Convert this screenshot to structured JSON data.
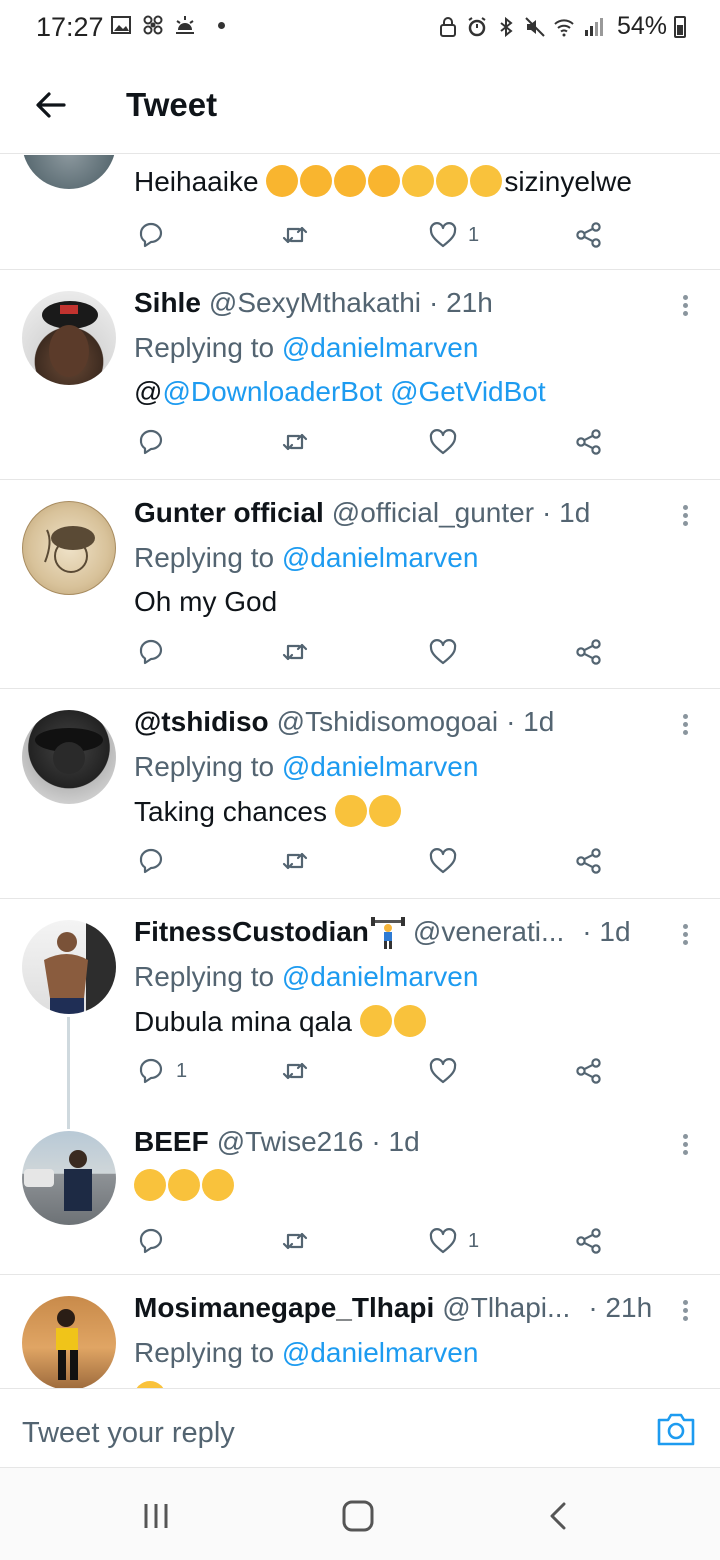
{
  "status_bar": {
    "time": "17:27",
    "battery": "54%",
    "left_icons": [
      "gallery-icon",
      "fan-icon",
      "weather-icon"
    ],
    "right_icons": [
      "lock-icon",
      "alarm-icon",
      "bluetooth-icon",
      "mute-icon",
      "wifi-icon",
      "signal-icon"
    ]
  },
  "header": {
    "title": "Tweet"
  },
  "tweets": [
    {
      "text_prefix": "Heihaaike",
      "emojis": [
        "angry",
        "angry",
        "angry",
        "angry",
        "cry",
        "cry",
        "cry"
      ],
      "text_suffix": "sizinyelwe",
      "reply_count": "",
      "like_count": "1"
    },
    {
      "name": "Sihle",
      "handle": "@SexyMthakathi",
      "time": "· 21h",
      "replying_label": "Replying to",
      "replying_to": "@danielmarven",
      "text_prefix": "@",
      "mentions": "@DownloaderBot @GetVidBot",
      "reply_count": "",
      "like_count": ""
    },
    {
      "name": "Gunter official",
      "handle": "@official_gunter",
      "time": "· 1d",
      "replying_label": "Replying to",
      "replying_to": "@danielmarven",
      "text": "Oh my God",
      "reply_count": "",
      "like_count": ""
    },
    {
      "name": "@tshidiso",
      "handle": "@Tshidisomogoai",
      "time": "· 1d",
      "replying_label": "Replying to",
      "replying_to": "@danielmarven",
      "text": "Taking chances",
      "emojis": [
        "laugh",
        "laugh"
      ],
      "reply_count": "",
      "like_count": ""
    },
    {
      "name": "FitnessCustodian",
      "handle": "@venerati...",
      "time": "· 1d",
      "replying_label": "Replying to",
      "replying_to": "@danielmarven",
      "text": "Dubula mina qala",
      "emojis": [
        "laugh",
        "rofl"
      ],
      "reply_count": "1",
      "like_count": ""
    },
    {
      "name": "BEEF",
      "handle": "@Twise216",
      "time": "· 1d",
      "emojis": [
        "rofl",
        "rofl",
        "rofl"
      ],
      "reply_count": "",
      "like_count": "1"
    },
    {
      "name": "Mosimanegape_Tlhapi",
      "handle": "@Tlhapi...",
      "time": "· 21h",
      "replying_label": "Replying to",
      "replying_to": "@danielmarven"
    }
  ],
  "composer": {
    "placeholder": "Tweet your reply"
  },
  "colors": {
    "accent": "#1d9bf0",
    "text": "#0f1419",
    "muted": "#536471"
  }
}
